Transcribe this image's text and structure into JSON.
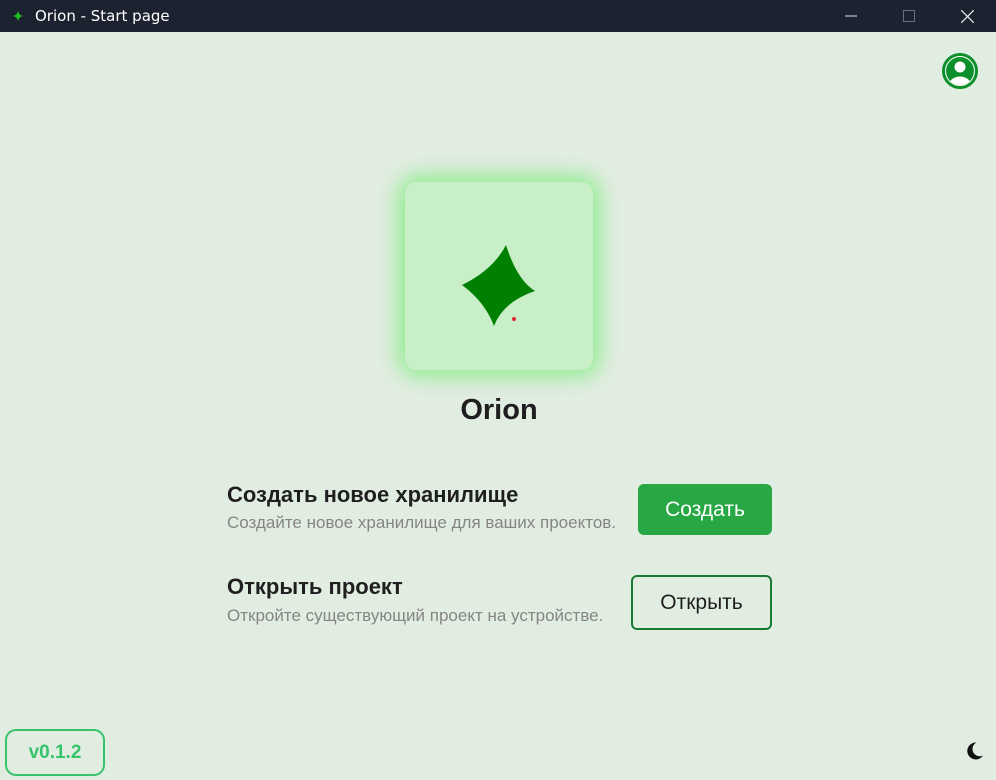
{
  "window": {
    "title": "Orion - Start page"
  },
  "app": {
    "name": "Orion",
    "version": "v0.1.2"
  },
  "actions": {
    "create": {
      "title": "Создать новое хранилище",
      "description": "Создайте новое хранилище для ваших проектов.",
      "button_label": "Создать"
    },
    "open": {
      "title": "Открыть проект",
      "description": "Откройте существующий проект на устройстве.",
      "button_label": "Открыть"
    }
  },
  "icons": {
    "app": "four-point-star-icon",
    "profile": "user-avatar-icon",
    "theme": "moon-icon",
    "minimize": "minimize-icon",
    "maximize": "maximize-icon",
    "close": "close-icon"
  },
  "colors": {
    "accent": "#27a844",
    "logo_green": "#008000",
    "logo_tile": "#c8efc8",
    "titlebar": "#1c2230",
    "background": "#e2ede2"
  }
}
